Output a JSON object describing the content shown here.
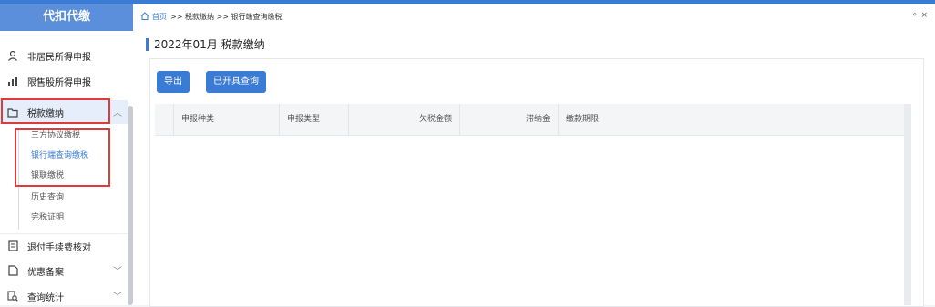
{
  "sidebar": {
    "title": "代扣代缴",
    "items": [
      {
        "label": "非居民所得申报",
        "icon": "user-icon"
      },
      {
        "label": "限售股所得申报",
        "icon": "bar-chart-icon"
      },
      {
        "label": "税款缴纳",
        "icon": "folder-icon",
        "expanded": true
      },
      {
        "label": "退付手续费核对",
        "icon": "document-icon"
      },
      {
        "label": "优惠备案",
        "icon": "file-icon"
      },
      {
        "label": "查询统计",
        "icon": "search-doc-icon"
      }
    ],
    "sub_items": [
      "三方协议缴税",
      "银行端查询缴税",
      "银联缴税",
      "历史查询",
      "完税证明"
    ],
    "selected_sub": "银行端查询缴税"
  },
  "breadcrumb": {
    "home": "首页",
    "rest": ">> 税款缴纳 >> 银行端查询缴税"
  },
  "window_controls": "⚬ ×",
  "page_title": "2022年01月 税款缴纳",
  "buttons": {
    "export": "导出",
    "issued_query": "已开具查询"
  },
  "table": {
    "columns": [
      "申报种类",
      "申报类型",
      "欠税金额",
      "滞纳金",
      "缴款期限"
    ],
    "rows": []
  },
  "colors": {
    "accent": "#3a7bd5",
    "highlight_box": "#e23a3a"
  }
}
